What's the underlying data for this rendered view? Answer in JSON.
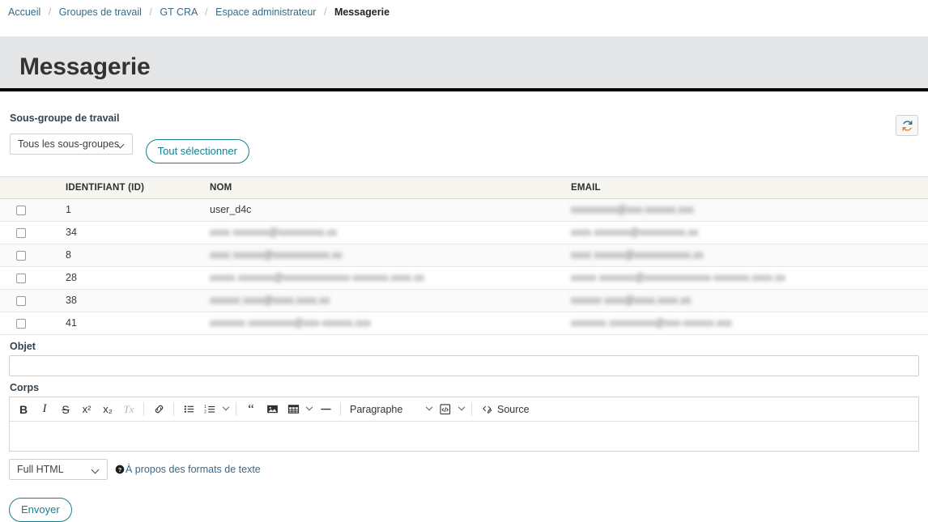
{
  "breadcrumb": {
    "items": [
      {
        "label": "Accueil",
        "current": false
      },
      {
        "label": "Groupes de travail",
        "current": false
      },
      {
        "label": "GT CRA",
        "current": false
      },
      {
        "label": "Espace administrateur",
        "current": false
      },
      {
        "label": "Messagerie",
        "current": true
      }
    ],
    "separator": "/"
  },
  "page": {
    "title": "Messagerie",
    "accent_color": "#157f92",
    "link_color": "#3a6a86",
    "title_band_bg": "#e3e5e6"
  },
  "filters": {
    "subgroup_label": "Sous-groupe de travail",
    "subgroup_value": "Tous les sous-groupes",
    "refresh_button_title": "Actualiser",
    "select_all_button": "Tout sélectionner"
  },
  "table": {
    "columns": [
      "",
      "IDENTIFIANT (ID)",
      "NOM",
      "EMAIL"
    ],
    "rows": [
      {
        "id": "1",
        "name": "user_d4c",
        "name_redacted": false,
        "email": "xxxxxxxxx@xxx-xxxxxx.xxx",
        "email_redacted": true
      },
      {
        "id": "34",
        "name": "xxxx xxxxxxx@xxxxxxxxx.xx",
        "name_redacted": true,
        "email": "xxxx xxxxxxx@xxxxxxxxx.xx",
        "email_redacted": true
      },
      {
        "id": "8",
        "name": "xxxx xxxxxx@xxxxxxxxxxx.xx",
        "name_redacted": true,
        "email": "xxxx xxxxxx@xxxxxxxxxxx.xx",
        "email_redacted": true
      },
      {
        "id": "28",
        "name": "xxxxx xxxxxxx@xxxxxxxxxxxxx-xxxxxxx.xxxx.xx",
        "name_redacted": true,
        "email": "xxxxx xxxxxxx@xxxxxxxxxxxxx-xxxxxxx.xxxx.xx",
        "email_redacted": true
      },
      {
        "id": "38",
        "name": "xxxxxx xxxx@xxxx.xxxx.xx",
        "name_redacted": true,
        "email": "xxxxxx xxxx@xxxx.xxxx.xx",
        "email_redacted": true
      },
      {
        "id": "41",
        "name": "xxxxxxx xxxxxxxxx@xxx-xxxxxx.xxx",
        "name_redacted": true,
        "email": "xxxxxxx xxxxxxxxx@xxx-xxxxxx.xxx",
        "email_redacted": true
      }
    ]
  },
  "form": {
    "subject_label": "Objet",
    "subject_value": "",
    "subject_placeholder": "",
    "body_label": "Corps",
    "body_value": "",
    "submit_label": "Envoyer"
  },
  "editor": {
    "toolbar": [
      {
        "name": "bold",
        "glyph": "B",
        "dim": false
      },
      {
        "name": "italic",
        "glyph": "I",
        "dim": false
      },
      {
        "name": "strikethrough",
        "glyph": "S",
        "dim": false
      },
      {
        "name": "superscript",
        "glyph": "x²",
        "dim": false
      },
      {
        "name": "subscript",
        "glyph": "x₂",
        "dim": false
      },
      {
        "name": "remove-format",
        "glyph": "Tx",
        "dim": true
      },
      {
        "name": "link",
        "glyph": "",
        "dim": false
      },
      {
        "name": "bulleted-list",
        "glyph": "",
        "dim": false
      },
      {
        "name": "numbered-list",
        "glyph": "",
        "dim": false
      },
      {
        "name": "blockquote",
        "glyph": "",
        "dim": false
      },
      {
        "name": "image",
        "glyph": "",
        "dim": false
      },
      {
        "name": "table",
        "glyph": "",
        "dim": false
      },
      {
        "name": "horizontal-line",
        "glyph": "",
        "dim": false
      }
    ],
    "paragraph_style": "Paragraphe",
    "source_label": "Source"
  },
  "text_format": {
    "value": "Full HTML",
    "help_label": "À propos des formats de texte"
  }
}
